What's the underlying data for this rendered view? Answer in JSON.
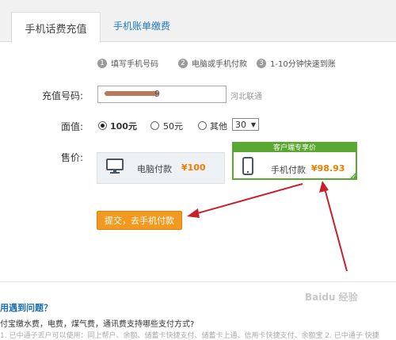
{
  "tabs": [
    {
      "label": "手机话费充值",
      "active": true
    },
    {
      "label": "手机账单缴费",
      "active": false
    }
  ],
  "steps": [
    {
      "num": "1",
      "label": "填写手机号码"
    },
    {
      "num": "2",
      "label": "电脑或手机付款"
    },
    {
      "num": "3",
      "label": "1-10分钟快速到账"
    }
  ],
  "form": {
    "phone_label": "充值号码:",
    "phone_value_tail": "9",
    "carrier": "河北联通",
    "face_label": "面值:",
    "face_options": [
      "100元",
      "50元",
      "其他"
    ],
    "face_selected": "100元",
    "other_amount": "30",
    "price_label": "售价:"
  },
  "payment": {
    "pc": {
      "label": "电脑付款",
      "price": "¥100"
    },
    "mobile": {
      "badge": "客户端专享价",
      "label": "手机付款",
      "price": "¥98.93",
      "selected": true
    }
  },
  "submit_label": "提交，去手机付款",
  "faq": {
    "title": "用遇到问题？",
    "question": "付宝缴水费，电费，煤气费，通讯费支持哪些支付方式?",
    "more": "1. 已中通子丢户可以使用：同上帮户、余额、储蓄卡快捷支付、储蓄卡上通、信用卡快捷支付、余额宝 2. 已中通子 快捷"
  },
  "watermark": "Baidu 经验",
  "colors": {
    "accent_green": "#5aa832",
    "price_orange": "#f07c00",
    "button_orange": "#f29a1f",
    "link_blue": "#1f7ac6",
    "arrow_red": "#c8202a"
  }
}
